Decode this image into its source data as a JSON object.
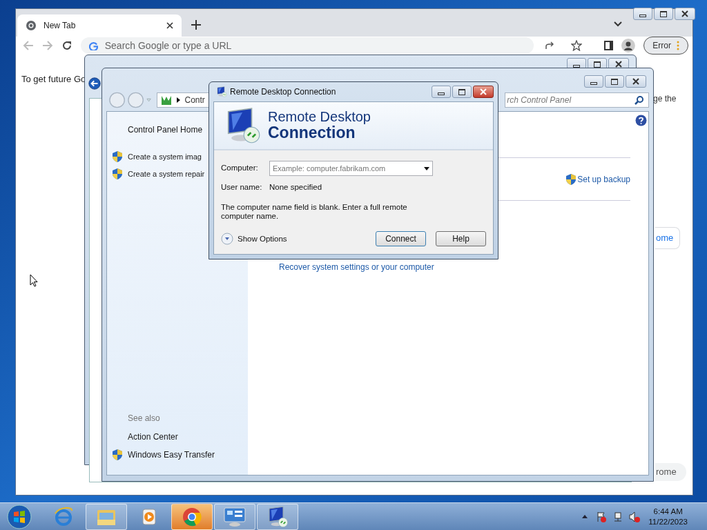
{
  "browser": {
    "tabs": [
      {
        "title": "New Tab",
        "selected": true
      }
    ],
    "omnibox": {
      "placeholder": "Search Google or type a URL"
    },
    "profile_button": {
      "label": "Error"
    },
    "page": {
      "info_text": "To get future Go",
      "side_text": "ge the",
      "buttons": [
        "ome",
        "rome"
      ]
    }
  },
  "control_panel": {
    "breadcrumb": "Contr",
    "search": {
      "placeholder": "rch Control Panel"
    },
    "sidebar": {
      "home": "Control Panel Home",
      "tasks": [
        "Create a system imag",
        "Create a system repair"
      ],
      "see_also_heading": "See also",
      "see_also": [
        {
          "label": "Action Center",
          "shield": false
        },
        {
          "label": "Windows Easy Transfer",
          "shield": true
        }
      ]
    },
    "backup_link": "Set up backup",
    "recover_link": "Recover system settings or your computer"
  },
  "dialog": {
    "title": "Remote Desktop Connection",
    "banner_line1": "Remote Desktop",
    "banner_line2": "Connection",
    "computer_label": "Computer:",
    "computer_placeholder": "Example: computer.fabrikam.com",
    "username_label": "User name:",
    "username": "None specified",
    "message": "The computer name field is blank. Enter a full remote computer name.",
    "show_options": "Show Options",
    "buttons": [
      "Connect",
      "Help"
    ]
  },
  "taskbar": {
    "apps": [
      {
        "kind": "ie",
        "running": false,
        "selected": false
      },
      {
        "kind": "explorer",
        "running": true,
        "selected": false
      },
      {
        "kind": "media",
        "running": false,
        "selected": false
      },
      {
        "kind": "chrome",
        "running": true,
        "selected": true
      },
      {
        "kind": "control-panel",
        "running": true,
        "selected": false
      },
      {
        "kind": "remote-desktop",
        "running": true,
        "selected": false
      }
    ],
    "clock": {
      "time": "6:44 AM",
      "date": "11/22/2023"
    }
  }
}
